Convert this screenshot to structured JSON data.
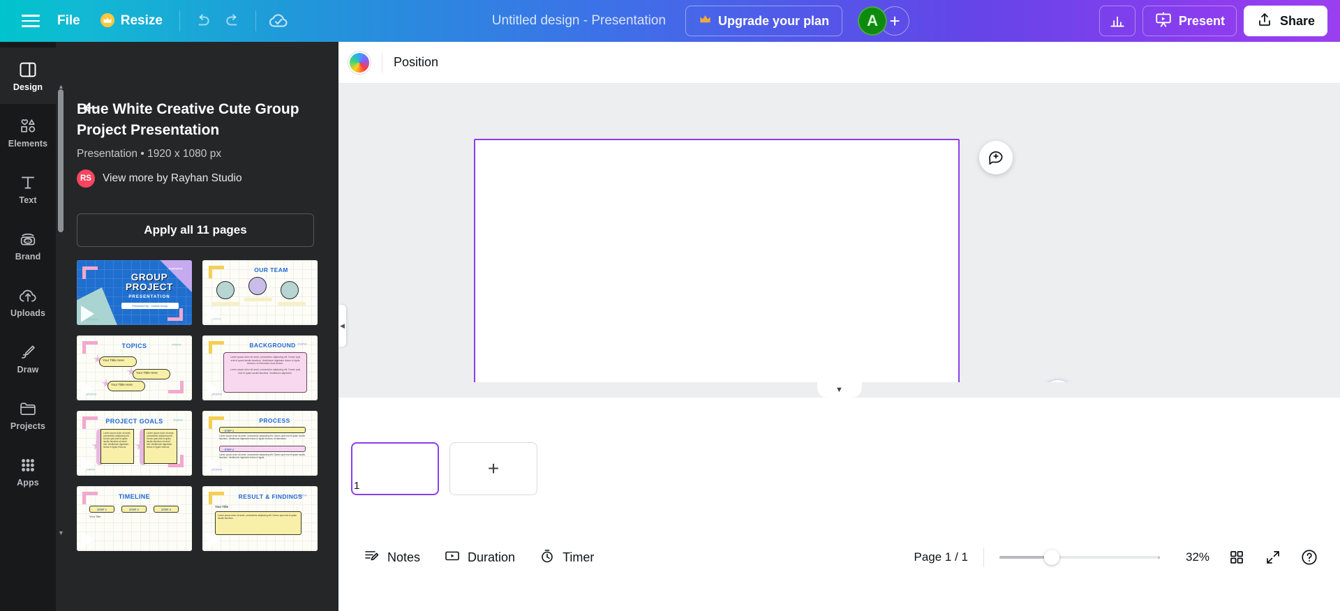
{
  "topbar": {
    "menu_icon": "hamburger-icon",
    "file_label": "File",
    "resize_label": "Resize",
    "resize_crown": "♛",
    "undo_icon": "undo-icon",
    "redo_icon": "redo-icon",
    "cloud_icon": "cloud-saved-icon",
    "doc_title": "Untitled design - Presentation",
    "upgrade_label": "Upgrade your plan",
    "upgrade_crown": "♛",
    "avatar_initial": "A",
    "avatar_add": "+",
    "avatar_color": "#0e8a0e",
    "insights_icon": "bar-chart-icon",
    "present_label": "Present",
    "present_icon": "present-screen-icon",
    "share_label": "Share",
    "share_icon": "share-upload-icon",
    "gradient_start": "#00c4cc",
    "gradient_end": "#9b3ff0"
  },
  "rail": {
    "items": [
      {
        "label": "Design",
        "icon": "design-layout-icon",
        "active": true
      },
      {
        "label": "Elements",
        "icon": "elements-shapes-icon",
        "active": false
      },
      {
        "label": "Text",
        "icon": "text-t-icon",
        "active": false
      },
      {
        "label": "Brand",
        "icon": "brand-kit-icon",
        "active": false
      },
      {
        "label": "Uploads",
        "icon": "uploads-cloud-icon",
        "active": false
      },
      {
        "label": "Draw",
        "icon": "draw-pen-icon",
        "active": false
      },
      {
        "label": "Projects",
        "icon": "projects-folder-icon",
        "active": false
      },
      {
        "label": "Apps",
        "icon": "apps-grid-icon",
        "active": false
      }
    ]
  },
  "panel": {
    "back_icon": "back-arrow-icon",
    "template_title": "Blue White Creative Cute Group Project Presentation",
    "template_meta": "Presentation • 1920 x 1080 px",
    "author_badge": "RS",
    "author_link": "View more by Rayhan Studio",
    "author_badge_color": "#f5455f",
    "apply_label": "Apply all 11 pages",
    "thumbnails": [
      {
        "heading": "GROUP PROJECT",
        "subheading": "PRESENTATION",
        "caption": "Presented by : Liberia Group",
        "style": "cover"
      },
      {
        "heading": "OUR TEAM",
        "subheading": "",
        "caption": "",
        "style": "team"
      },
      {
        "heading": "TOPICS",
        "subheading": "",
        "caption": "Your Tittle Here",
        "style": "topics"
      },
      {
        "heading": "BACKGROUND",
        "subheading": "",
        "caption": "",
        "style": "background"
      },
      {
        "heading": "PROJECT GOALS",
        "subheading": "",
        "caption": "",
        "style": "goals"
      },
      {
        "heading": "PROCESS",
        "subheading": "· STEP 1",
        "caption": "· STEP 2",
        "style": "process"
      },
      {
        "heading": "TIMELINE",
        "subheading": "STEP 1",
        "caption": "Your Title",
        "style": "timeline"
      },
      {
        "heading": "RESULT & FINDINGS",
        "subheading": "",
        "caption": "Your Title",
        "style": "result"
      }
    ]
  },
  "editor": {
    "toolbar": {
      "color_swatch": "rainbow-color-swatch",
      "position_label": "Position"
    },
    "canvas": {
      "page_border_color": "#8b3dee",
      "comment_icon": "add-comment-icon",
      "magic_icon": "magic-studio-sparkle-icon",
      "collapse_icon": "collapse-panel-icon",
      "chevron_icon": "chevron-down-icon"
    },
    "pages": {
      "current_page_number": "1",
      "add_page_icon": "plus-icon"
    },
    "bottombar": {
      "notes_label": "Notes",
      "notes_icon": "notes-pencil-icon",
      "duration_label": "Duration",
      "duration_icon": "duration-play-icon",
      "timer_label": "Timer",
      "timer_icon": "timer-stopwatch-icon",
      "page_count": "Page 1 / 1",
      "zoom_percent": "32%",
      "grid_icon": "grid-view-icon",
      "fullscreen_icon": "fullscreen-expand-icon",
      "help_icon": "help-question-icon"
    }
  }
}
